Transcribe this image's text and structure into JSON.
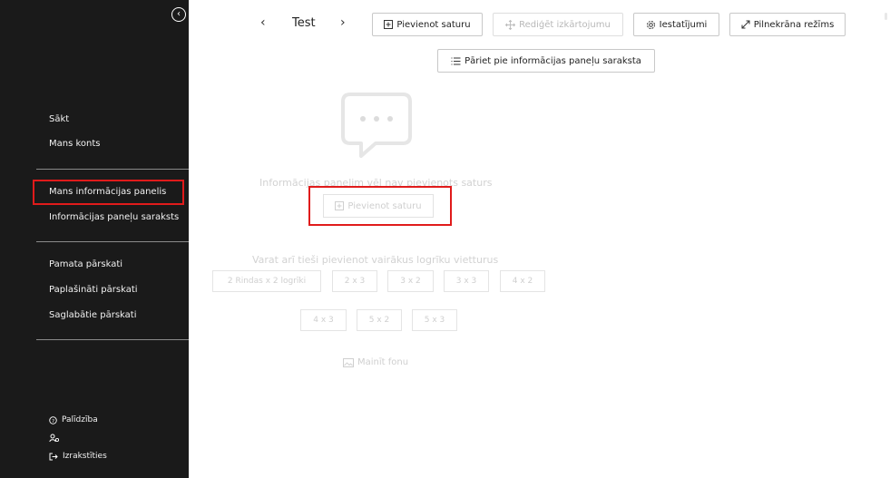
{
  "sidebar": {
    "top_items": [
      "Sākt",
      "Mans konts"
    ],
    "dashboard_items": [
      "Mans informācijas panelis",
      "Informācijas paneļu saraksts"
    ],
    "report_items": [
      "Pamata pārskati",
      "Paplašināti pārskati",
      "Saglabātie pārskati"
    ],
    "help_label": "Palīdzība",
    "logout_label": "Izrakstīties",
    "collapse_glyph": "‹"
  },
  "header": {
    "dashboard_name": "Test",
    "prev_glyph": "‹",
    "next_glyph": "›",
    "add_content": "Pievienot saturu",
    "edit_layout": "Rediģēt izkārtojumu",
    "settings": "Iestatījumi",
    "fullscreen": "Pilnekrāna režīms",
    "go_to_list": "Pāriet pie informācijas paneļu saraksta"
  },
  "empty_state": {
    "message": "Informācijas panelim vēl nav pievienots saturs",
    "add_content_button": "Pievienot saturu",
    "placeholder_intro": "Varat arī tieši pievienot vairākus logrīku vietturus",
    "grid_options_row1": [
      "2 Rindas x 2 logrīki",
      "2 x 3",
      "3 x 2",
      "3 x 3",
      "4 x 2"
    ],
    "grid_options_row2": [
      "4 x 3",
      "5 x 2",
      "5 x 3"
    ],
    "change_background": "Mainīt fonu"
  },
  "colors": {
    "sidebar_bg": "#1a1a1a",
    "highlight": "#e01b1b"
  }
}
